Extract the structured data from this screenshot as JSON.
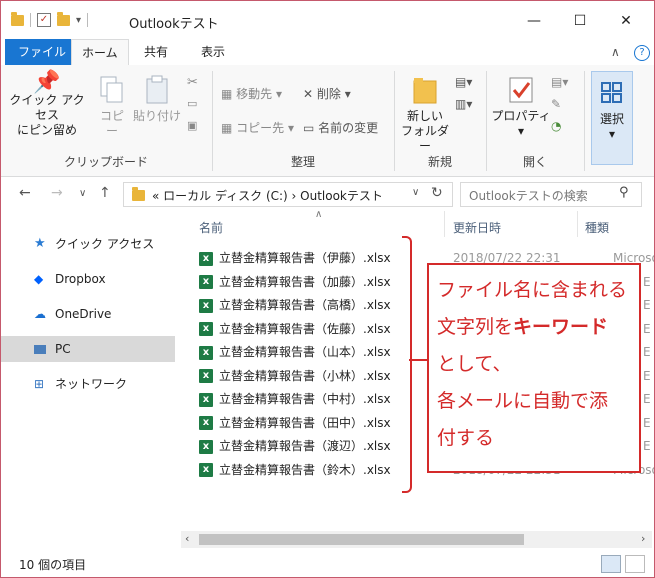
{
  "window": {
    "title": "Outlookテスト",
    "minimize": "—",
    "maximize": "☐",
    "close": "✕",
    "accent": "#1976d2"
  },
  "ribbon_tabs": {
    "file": "ファイル",
    "home": "ホーム",
    "share": "共有",
    "view": "表示",
    "collapse": "∧",
    "help": "?"
  },
  "ribbon": {
    "clipboard": {
      "label": "クリップボード",
      "pin_line1": "クイック アクセス",
      "pin_line2": "にピン留め",
      "copy": "コピー",
      "paste": "貼り付け"
    },
    "organize": {
      "label": "整理",
      "move_to": "移動先",
      "copy_to": "コピー先",
      "delete": "削除",
      "rename": "名前の変更"
    },
    "new": {
      "label": "新規",
      "new_folder_line1": "新しい",
      "new_folder_line2": "フォルダー"
    },
    "open": {
      "label": "開く",
      "properties": "プロパティ"
    },
    "select": {
      "label": "選択"
    }
  },
  "address": {
    "path": "« ローカル ディスク (C:)  ›  Outlookテスト",
    "search_placeholder": "Outlookテストの検索"
  },
  "nav": {
    "items": [
      {
        "label": "クイック アクセス"
      },
      {
        "label": "Dropbox"
      },
      {
        "label": "OneDrive"
      },
      {
        "label": "PC"
      },
      {
        "label": "ネットワーク"
      }
    ]
  },
  "columns": {
    "name": "名前",
    "date": "更新日時",
    "type": "種類"
  },
  "files": [
    {
      "name": "立替金精算報告書（伊藤）.xlsx",
      "date": "2018/07/22 22:31",
      "type": "Microsoft E"
    },
    {
      "name": "立替金精算報告書（加藤）.xlsx",
      "date": "",
      "type": "E"
    },
    {
      "name": "立替金精算報告書（高橋）.xlsx",
      "date": "",
      "type": "E"
    },
    {
      "name": "立替金精算報告書（佐藤）.xlsx",
      "date": "",
      "type": "E"
    },
    {
      "name": "立替金精算報告書（山本）.xlsx",
      "date": "",
      "type": "E"
    },
    {
      "name": "立替金精算報告書（小林）.xlsx",
      "date": "",
      "type": "E"
    },
    {
      "name": "立替金精算報告書（中村）.xlsx",
      "date": "",
      "type": "E"
    },
    {
      "name": "立替金精算報告書（田中）.xlsx",
      "date": "",
      "type": "E"
    },
    {
      "name": "立替金精算報告書（渡辺）.xlsx",
      "date": "",
      "type": "E"
    },
    {
      "name": "立替金精算報告書（鈴木）.xlsx",
      "date": "2018/07/22 22:31",
      "type": "Microsoft E"
    }
  ],
  "callout": {
    "line1": "ファイル名に含まれる",
    "line2_pre": "文字列を",
    "line2_bold": "キーワード",
    "line3": "として、",
    "line4": "各メールに自動で添",
    "line5": "付する",
    "color": "#d42a2a"
  },
  "status": {
    "count": "10 個の項目"
  }
}
